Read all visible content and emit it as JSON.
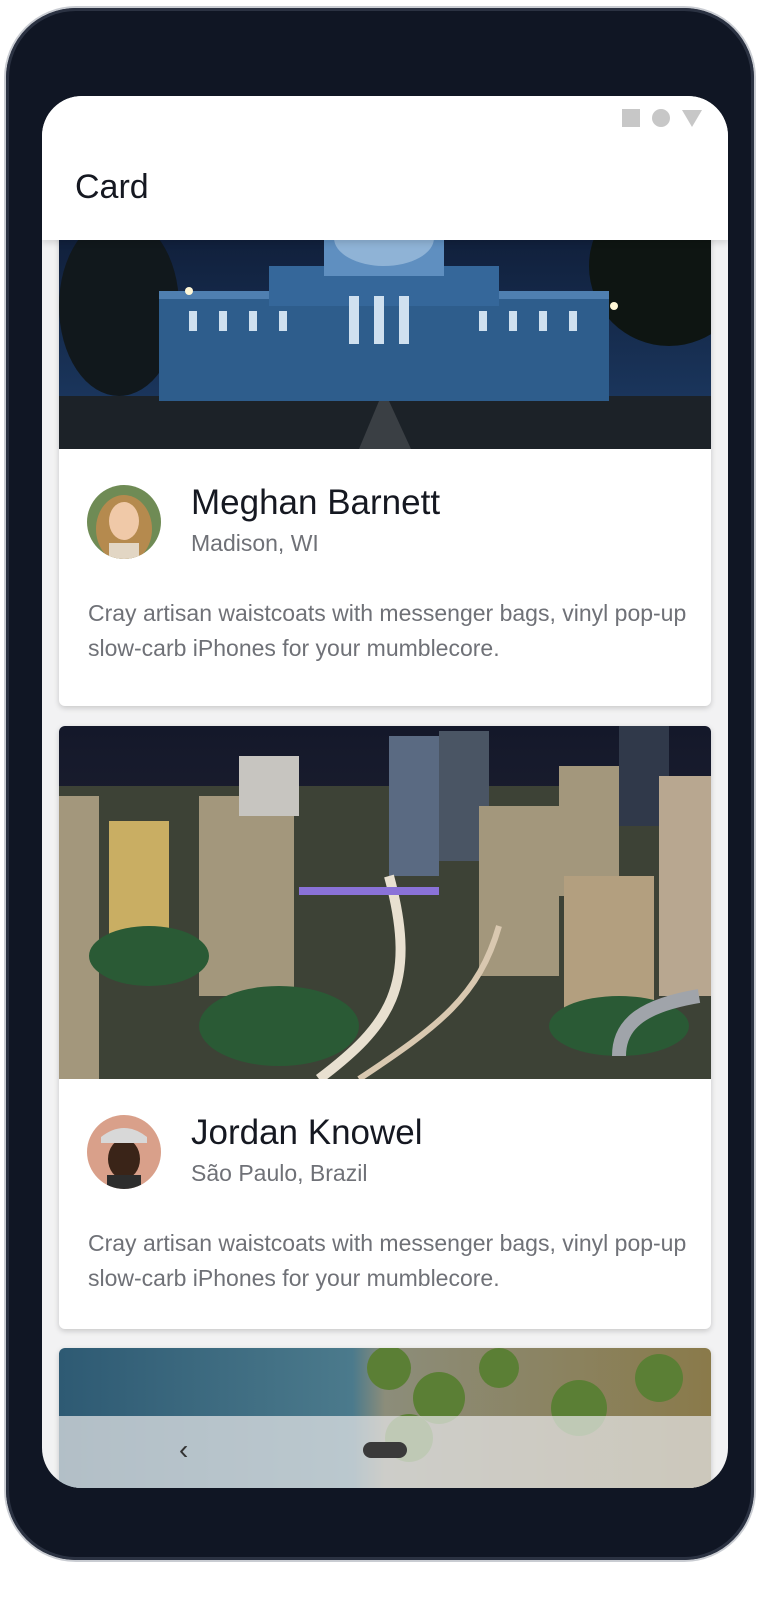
{
  "app_bar": {
    "title": "Card"
  },
  "status_bar": {
    "icons": [
      "square-icon",
      "circle-icon",
      "triangle-icon"
    ]
  },
  "cards": [
    {
      "name": "Meghan Barnett",
      "location": "Madison, WI",
      "description": "Cray artisan waistcoats with messenger bags, vinyl pop-up slow-carb iPhones for your mumblecore."
    },
    {
      "name": "Jordan Knowel",
      "location": "São Paulo, Brazil",
      "description": "Cray artisan waistcoats with messenger bags, vinyl pop-up slow-carb iPhones for your mumblecore."
    }
  ],
  "nav_bar": {
    "back_symbol": "‹"
  },
  "colors": {
    "frame": "#101624",
    "title_text": "#151821",
    "secondary_text": "#6f7177"
  }
}
